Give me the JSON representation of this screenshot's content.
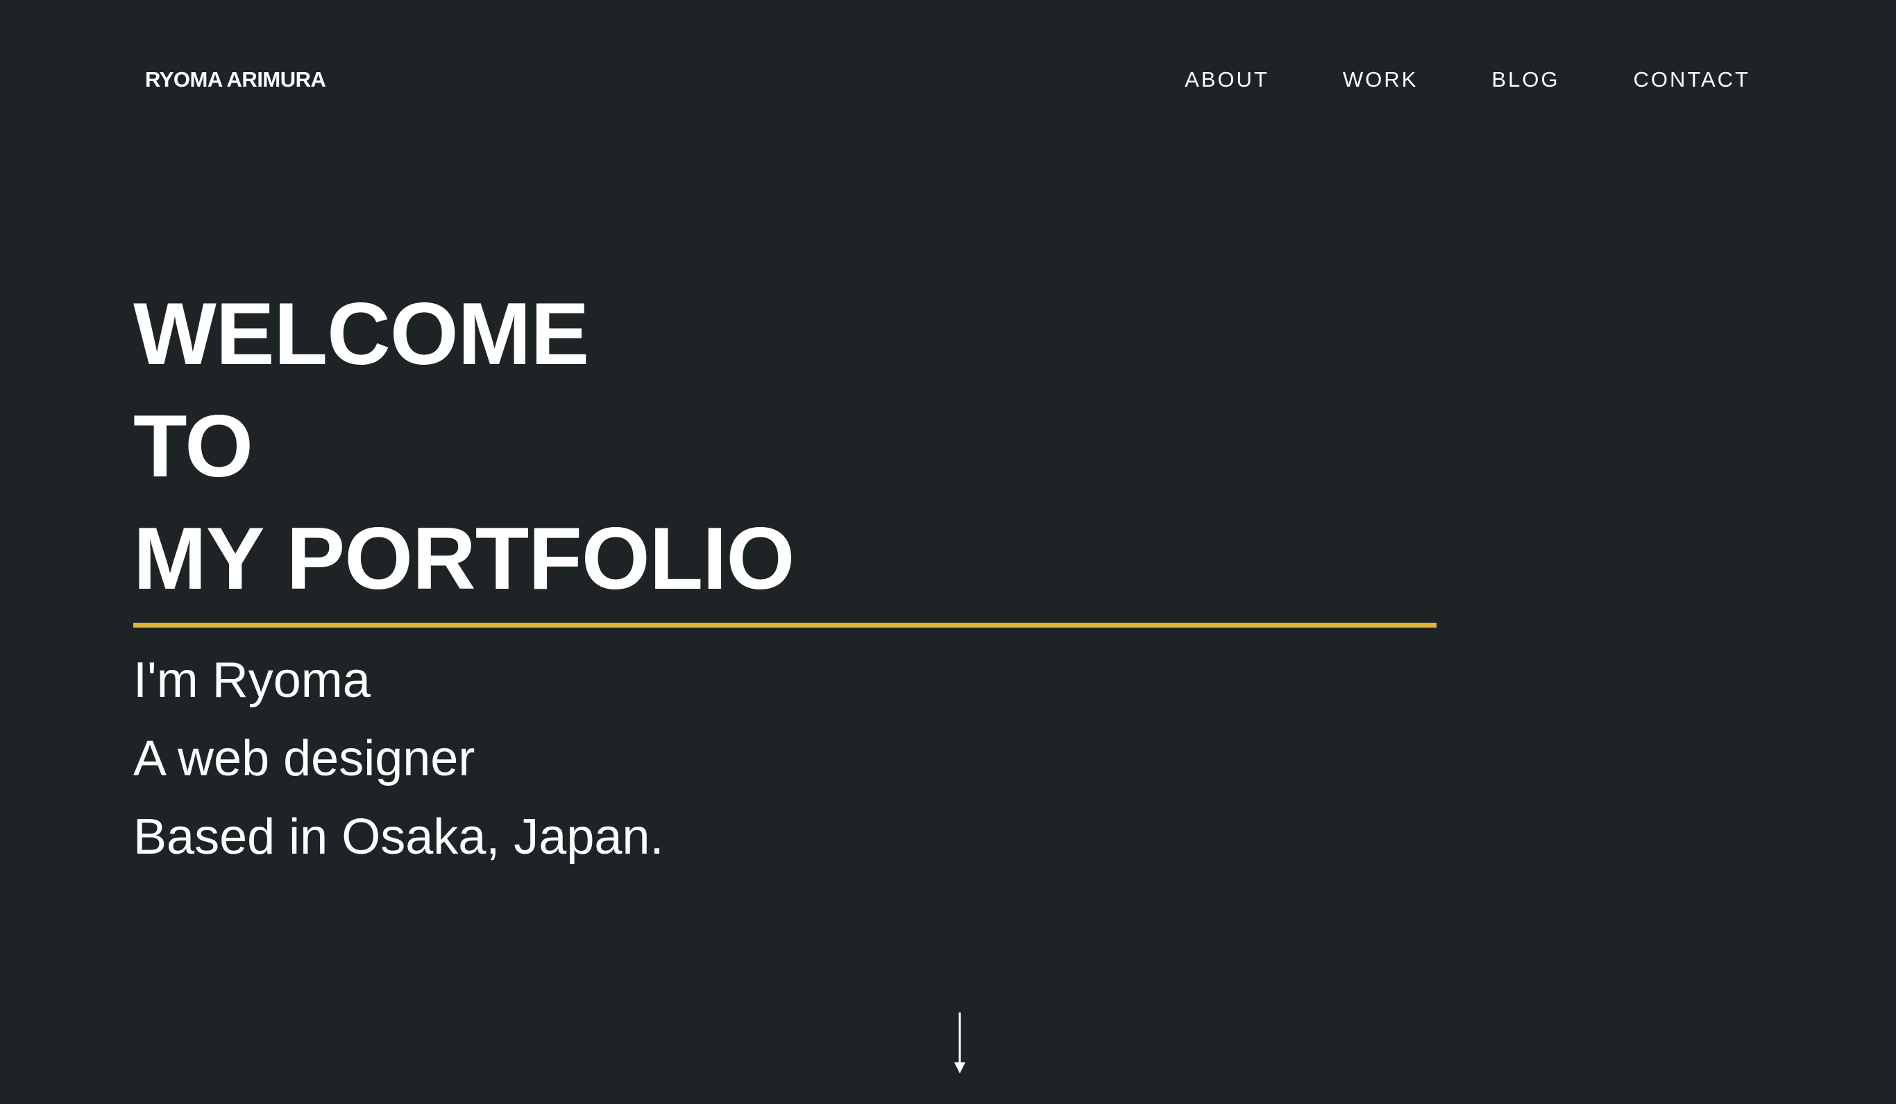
{
  "header": {
    "logo": "RYOMA ARIMURA",
    "nav": [
      {
        "label": "ABOUT"
      },
      {
        "label": "WORK"
      },
      {
        "label": "BLOG"
      },
      {
        "label": "CONTACT"
      }
    ]
  },
  "hero": {
    "title_lines": [
      "WELCOME",
      "TO",
      "MY PORTFOLIO"
    ],
    "intro_lines": [
      "I'm Ryoma",
      "A web designer",
      "Based in Osaka, Japan."
    ]
  },
  "scroll": {
    "icon": "arrow-down-icon"
  },
  "colors": {
    "background": "#1e2326",
    "text": "#ffffff",
    "accent": "#e0b53a"
  }
}
